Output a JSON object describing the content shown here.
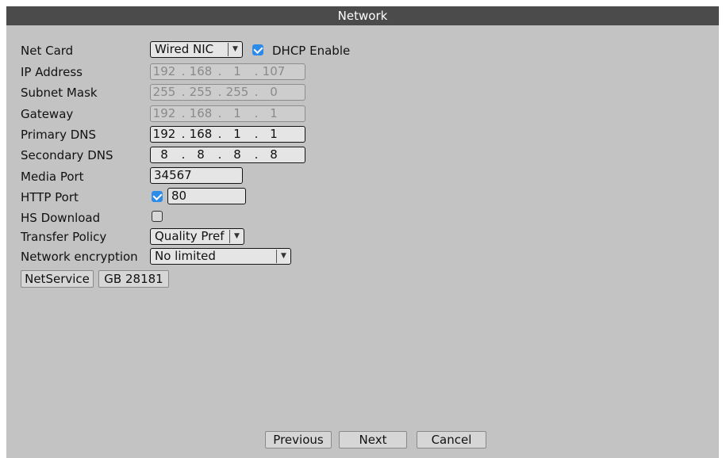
{
  "window": {
    "title": "Network"
  },
  "form": {
    "net_card": {
      "label": "Net Card",
      "value": "Wired NIC"
    },
    "dhcp": {
      "label": "DHCP Enable",
      "checked": true
    },
    "ip_address": {
      "label": "IP Address",
      "octets": [
        "192",
        "168",
        "1",
        "107"
      ],
      "disabled": true
    },
    "subnet_mask": {
      "label": "Subnet Mask",
      "octets": [
        "255",
        "255",
        "255",
        "0"
      ],
      "disabled": true
    },
    "gateway": {
      "label": "Gateway",
      "octets": [
        "192",
        "168",
        "1",
        "1"
      ],
      "disabled": true
    },
    "primary_dns": {
      "label": "Primary DNS",
      "octets": [
        "192",
        "168",
        "1",
        "1"
      ]
    },
    "secondary_dns": {
      "label": "Secondary DNS",
      "octets": [
        "8",
        "8",
        "8",
        "8"
      ]
    },
    "media_port": {
      "label": "Media Port",
      "value": "34567"
    },
    "http_port": {
      "label": "HTTP Port",
      "checked": true,
      "value": "80"
    },
    "hs_download": {
      "label": "HS Download",
      "checked": false
    },
    "transfer_policy": {
      "label": "Transfer Policy",
      "value": "Quality Pref"
    },
    "network_encryption": {
      "label": "Network encryption",
      "value": "No limited"
    }
  },
  "service_buttons": {
    "netservice": "NetService",
    "gb28181": "GB 28181"
  },
  "footer": {
    "previous": "Previous",
    "next": "Next",
    "cancel": "Cancel"
  },
  "colors": {
    "accent": "#2d8bea",
    "panel": "#c3c3c3",
    "titlebar": "#4b4b4b"
  }
}
